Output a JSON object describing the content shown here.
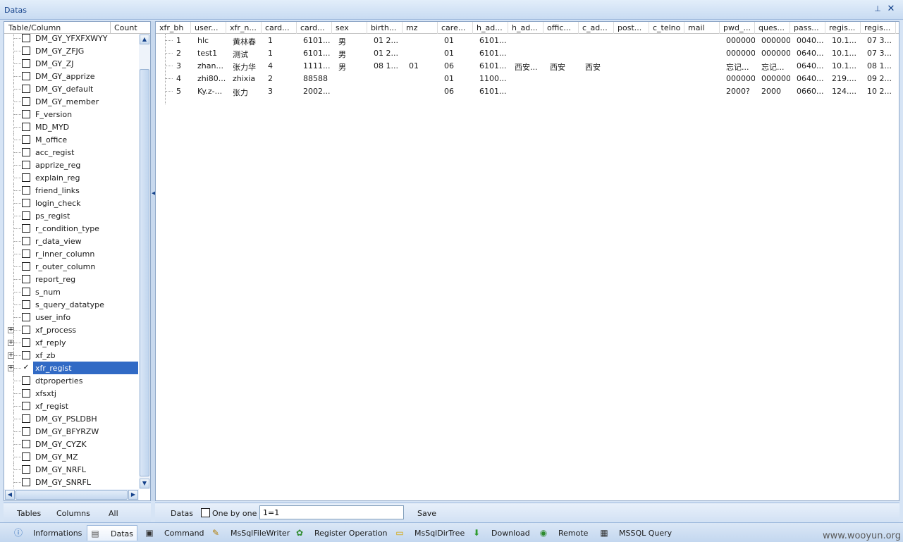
{
  "window": {
    "title": "Datas"
  },
  "tree": {
    "header": {
      "col1": "Table/Column",
      "col2": "Count"
    },
    "items": [
      {
        "label": "DM_GY_YFXFXWYY",
        "checked": false,
        "expandable": false
      },
      {
        "label": "DM_GY_ZFJG",
        "checked": false,
        "expandable": false
      },
      {
        "label": "DM_GY_ZJ",
        "checked": false,
        "expandable": false
      },
      {
        "label": "DM_GY_apprize",
        "checked": false,
        "expandable": false
      },
      {
        "label": "DM_GY_default",
        "checked": false,
        "expandable": false
      },
      {
        "label": "DM_GY_member",
        "checked": false,
        "expandable": false
      },
      {
        "label": "F_version",
        "checked": false,
        "expandable": false
      },
      {
        "label": "MD_MYD",
        "checked": false,
        "expandable": false
      },
      {
        "label": "M_office",
        "checked": false,
        "expandable": false
      },
      {
        "label": "acc_regist",
        "checked": false,
        "expandable": false
      },
      {
        "label": "apprize_reg",
        "checked": false,
        "expandable": false
      },
      {
        "label": "explain_reg",
        "checked": false,
        "expandable": false
      },
      {
        "label": "friend_links",
        "checked": false,
        "expandable": false
      },
      {
        "label": "login_check",
        "checked": false,
        "expandable": false
      },
      {
        "label": "ps_regist",
        "checked": false,
        "expandable": false
      },
      {
        "label": "r_condition_type",
        "checked": false,
        "expandable": false
      },
      {
        "label": "r_data_view",
        "checked": false,
        "expandable": false
      },
      {
        "label": "r_inner_column",
        "checked": false,
        "expandable": false
      },
      {
        "label": "r_outer_column",
        "checked": false,
        "expandable": false
      },
      {
        "label": "report_reg",
        "checked": false,
        "expandable": false
      },
      {
        "label": "s_num",
        "checked": false,
        "expandable": false
      },
      {
        "label": "s_query_datatype",
        "checked": false,
        "expandable": false
      },
      {
        "label": "user_info",
        "checked": false,
        "expandable": false
      },
      {
        "label": "xf_process",
        "checked": false,
        "expandable": true
      },
      {
        "label": "xf_reply",
        "checked": false,
        "expandable": true
      },
      {
        "label": "xf_zb",
        "checked": false,
        "expandable": true
      },
      {
        "label": "xfr_regist",
        "checked": true,
        "expandable": true,
        "selected": true
      },
      {
        "label": "dtproperties",
        "checked": false,
        "expandable": false
      },
      {
        "label": "xfsxtj",
        "checked": false,
        "expandable": false
      },
      {
        "label": "xf_regist",
        "checked": false,
        "expandable": false
      },
      {
        "label": "DM_GY_PSLDBH",
        "checked": false,
        "expandable": false
      },
      {
        "label": "DM_GY_BFYRZW",
        "checked": false,
        "expandable": false
      },
      {
        "label": "DM_GY_CYZK",
        "checked": false,
        "expandable": false
      },
      {
        "label": "DM_GY_MZ",
        "checked": false,
        "expandable": false
      },
      {
        "label": "DM_GY_NRFL",
        "checked": false,
        "expandable": false
      },
      {
        "label": "DM_GY_SNRFL",
        "checked": false,
        "expandable": false
      }
    ]
  },
  "grid": {
    "columns": [
      "xfr_bh",
      "user...",
      "xfr_n...",
      "card...",
      "card...",
      "sex",
      "birth...",
      "mz",
      "care...",
      "h_ad...",
      "h_ad...",
      "offic...",
      "c_ad...",
      "post...",
      "c_telno",
      "mail",
      "pwd_...",
      "ques...",
      "pass...",
      "regis...",
      "regis..."
    ],
    "rows": [
      [
        "1",
        "hlc",
        "黄林春",
        "1",
        "6101...",
        "男",
        "01 2...",
        "",
        "01",
        "6101...",
        "",
        "",
        "",
        "",
        "",
        "",
        "000000",
        "000000",
        "0040...",
        "10.1...",
        "07 3..."
      ],
      [
        "2",
        "test1",
        "测试",
        "1",
        "6101...",
        "男",
        "01 2...",
        "",
        "01",
        "6101...",
        "",
        "",
        "",
        "",
        "",
        "",
        "000000",
        "000000",
        "0640...",
        "10.1...",
        "07 3..."
      ],
      [
        "3",
        "zhan...",
        "张力华",
        "4",
        "1111...",
        "男",
        "08 1...",
        "01",
        "06",
        "6101...",
        "西安...",
        "西安",
        "西安",
        "",
        "",
        "",
        "忘记...",
        "忘记...",
        "0640...",
        "10.1...",
        "08 1..."
      ],
      [
        "4",
        "zhi80...",
        "zhixia",
        "2",
        "88588",
        "",
        "",
        "",
        "01",
        "1100...",
        "",
        "",
        "",
        "",
        "",
        "",
        "000000",
        "000000",
        "0640...",
        "219....",
        "09 2..."
      ],
      [
        "5",
        "Ky.z-...",
        "张力",
        "3",
        "2002...",
        "",
        "",
        "",
        "06",
        "6101...",
        "",
        "",
        "",
        "",
        "",
        "",
        "2000?",
        "2000",
        "0660...",
        "124....",
        "10 2..."
      ]
    ]
  },
  "left_tools": {
    "tables": "Tables",
    "columns": "Columns",
    "all": "All"
  },
  "right_tools": {
    "datas": "Datas",
    "one_by_one": "One by one",
    "where_value": "1=1",
    "save": "Save"
  },
  "tabs": [
    {
      "label": "Informations",
      "icon": "info-icon"
    },
    {
      "label": "Datas",
      "icon": "database-icon",
      "active": true
    },
    {
      "label": "Command",
      "icon": "terminal-icon"
    },
    {
      "label": "MsSqlFileWriter",
      "icon": "file-writer-icon"
    },
    {
      "label": "Register Operation",
      "icon": "registry-icon"
    },
    {
      "label": "MsSqlDirTree",
      "icon": "folder-icon"
    },
    {
      "label": "Download",
      "icon": "download-icon"
    },
    {
      "label": "Remote",
      "icon": "globe-icon"
    },
    {
      "label": "MSSQL Query",
      "icon": "sql-icon"
    }
  ],
  "watermark": "www.wooyun.org"
}
